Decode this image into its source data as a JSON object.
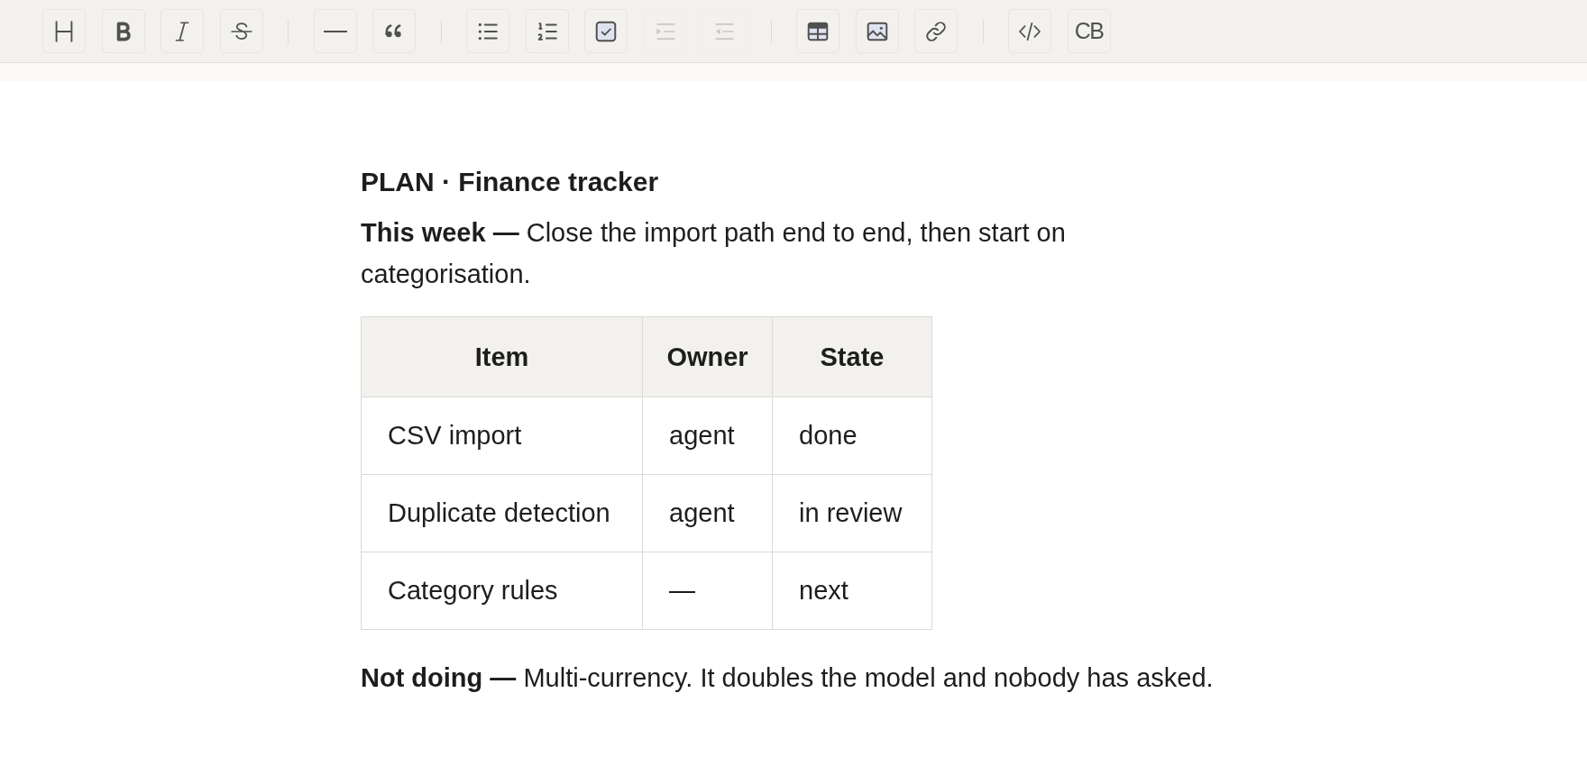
{
  "toolbar": {
    "groups": [
      [
        {
          "kind": "heading",
          "disabled": false
        },
        {
          "kind": "bold",
          "disabled": false
        },
        {
          "kind": "italic",
          "disabled": false
        },
        {
          "kind": "strike",
          "disabled": false
        }
      ],
      [
        {
          "kind": "rule",
          "disabled": false
        },
        {
          "kind": "quote",
          "disabled": false
        }
      ],
      [
        {
          "kind": "bullets",
          "disabled": false
        },
        {
          "kind": "numbers",
          "disabled": false
        },
        {
          "kind": "tasks",
          "disabled": false
        },
        {
          "kind": "indent",
          "disabled": true
        },
        {
          "kind": "outdent",
          "disabled": true
        }
      ],
      [
        {
          "kind": "table",
          "disabled": false
        },
        {
          "kind": "image",
          "disabled": false
        },
        {
          "kind": "link",
          "disabled": false
        }
      ],
      [
        {
          "kind": "code",
          "disabled": false
        },
        {
          "kind": "label",
          "label": "CB",
          "disabled": false
        }
      ]
    ]
  },
  "document": {
    "title": "PLAN · Finance tracker",
    "intro": "**This week —** Close the import path end to end, then start on categorisation.",
    "table": {
      "columns": [
        "Item",
        "Owner",
        "State"
      ],
      "rows": [
        [
          "CSV import",
          "agent",
          "done"
        ],
        [
          "Duplicate detection",
          "agent",
          "in review"
        ],
        [
          "Category rules",
          "—",
          "next"
        ]
      ]
    },
    "outro": "**Not doing —** Multi-currency. It doubles the model and nobody has asked."
  }
}
